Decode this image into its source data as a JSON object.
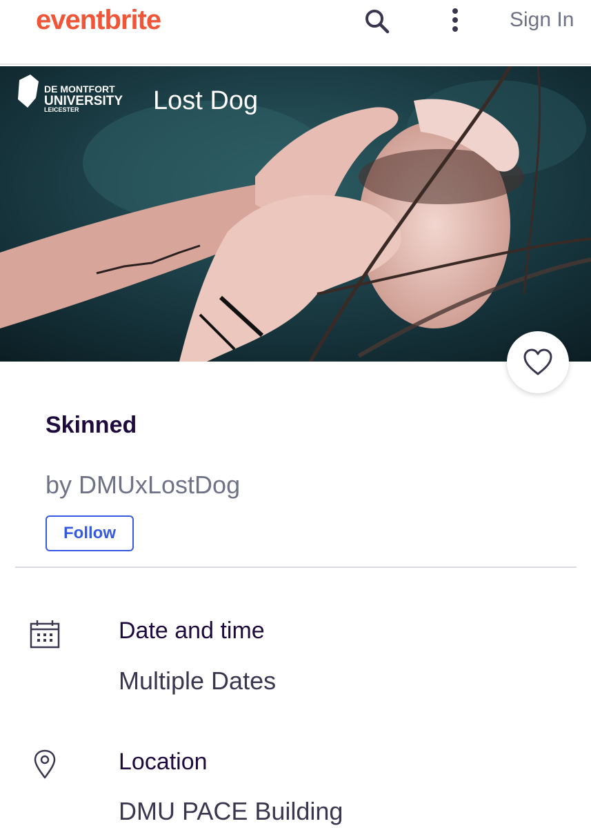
{
  "header": {
    "logo_text": "eventbrite",
    "search_icon": "search-icon",
    "more_icon": "more-vertical-icon",
    "signin_label": "Sign In"
  },
  "hero": {
    "image_description_icon": "event-banner-image",
    "logo_dmu_lines": [
      "DE MONTFORT",
      "UNIVERSITY",
      "LEICESTER"
    ],
    "logo_lostdog_text": "Lost Dog"
  },
  "event": {
    "title": "Skinned",
    "organizer": "by DMUxLostDog",
    "follow_label": "Follow",
    "like_icon": "heart-icon"
  },
  "details": {
    "date": {
      "icon": "calendar-icon",
      "label": "Date and time",
      "value": "Multiple Dates"
    },
    "location": {
      "icon": "location-pin-icon",
      "label": "Location",
      "value": "DMU PACE Building"
    }
  },
  "colors": {
    "brand": "#f05537",
    "accent_blue": "#3659e3",
    "title_text": "#1e0a3c",
    "muted_text": "#6f7287"
  }
}
